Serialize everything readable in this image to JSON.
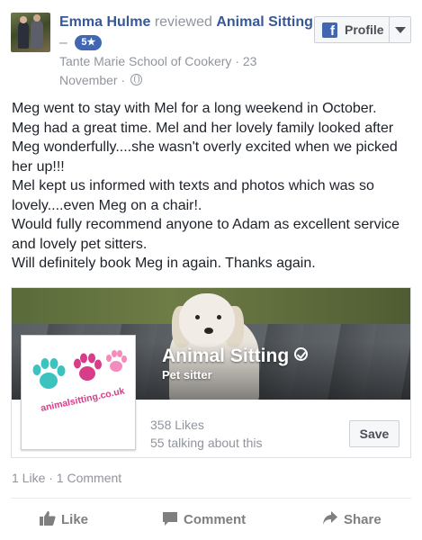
{
  "post": {
    "author": "Emma Hulme",
    "verb": "reviewed",
    "page_name": "Animal Sitting",
    "dash": "–",
    "rating": "5★",
    "meta": "Tante Marie School of Cookery · 23 November ·"
  },
  "profile_button": {
    "label": "Profile",
    "fb_letter": "f"
  },
  "review": {
    "lines": [
      "Meg went to stay with Mel for a long weekend in October.",
      "Meg had a great time. Mel and her lovely family looked after Meg wonderfully....she wasn't overly excited when we picked her up!!!",
      "Mel kept us informed with texts and photos which was so lovely....even Meg on a chair!.",
      "Would fully recommend anyone to Adam as excellent service and lovely pet sitters.",
      "Will definitely book Meg in again. Thanks again."
    ]
  },
  "page_card": {
    "title": "Animal Sitting",
    "category": "Pet sitter",
    "likes": "358 Likes",
    "talking": "55 talking about this",
    "save_label": "Save",
    "logo_text": "animalsitting.co.uk"
  },
  "counts": "1 Like · 1 Comment",
  "actions": {
    "like": "Like",
    "comment": "Comment",
    "share": "Share"
  },
  "colors": {
    "link": "#365899",
    "meta": "#90949c",
    "badge": "#4267b2",
    "paw_teal": "#3cc3c0",
    "paw_pink": "#d83d8a",
    "paw_light_pink": "#f38bbd"
  }
}
